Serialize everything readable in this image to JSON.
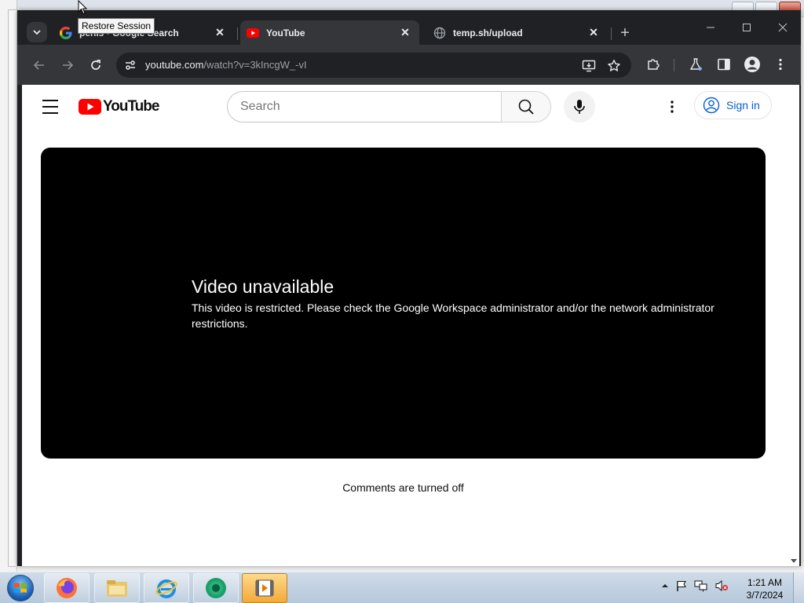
{
  "tooltip": {
    "text": "Restore Session"
  },
  "browser": {
    "tabs": [
      {
        "title": "penis - Google Search",
        "icon": "google-icon",
        "active": false
      },
      {
        "title": "YouTube",
        "icon": "youtube-icon",
        "active": true
      },
      {
        "title": "temp.sh/upload",
        "icon": "globe-icon",
        "active": false
      }
    ],
    "new_tab_label": "+",
    "url_host": "youtube.com",
    "url_path": "/watch?v=3kIncgW_-vI"
  },
  "youtube": {
    "logo_text": "YouTube",
    "search_placeholder": "Search",
    "sign_in_label": "Sign in",
    "error_title": "Video unavailable",
    "error_body": "This video is restricted. Please check the Google Workspace administrator and/or the network administrator restrictions.",
    "comments_message": "Comments are turned off"
  },
  "taskbar": {
    "apps": [
      "firefox-icon",
      "file-explorer-icon",
      "internet-explorer-icon",
      "chrome-icon",
      "media-player-icon"
    ],
    "time": "1:21 AM",
    "date": "3/7/2024"
  },
  "colors": {
    "youtube_red": "#ff0000",
    "link_blue": "#065fd4",
    "chrome_dark": "#202124",
    "chrome_toolbar": "#35363a"
  }
}
